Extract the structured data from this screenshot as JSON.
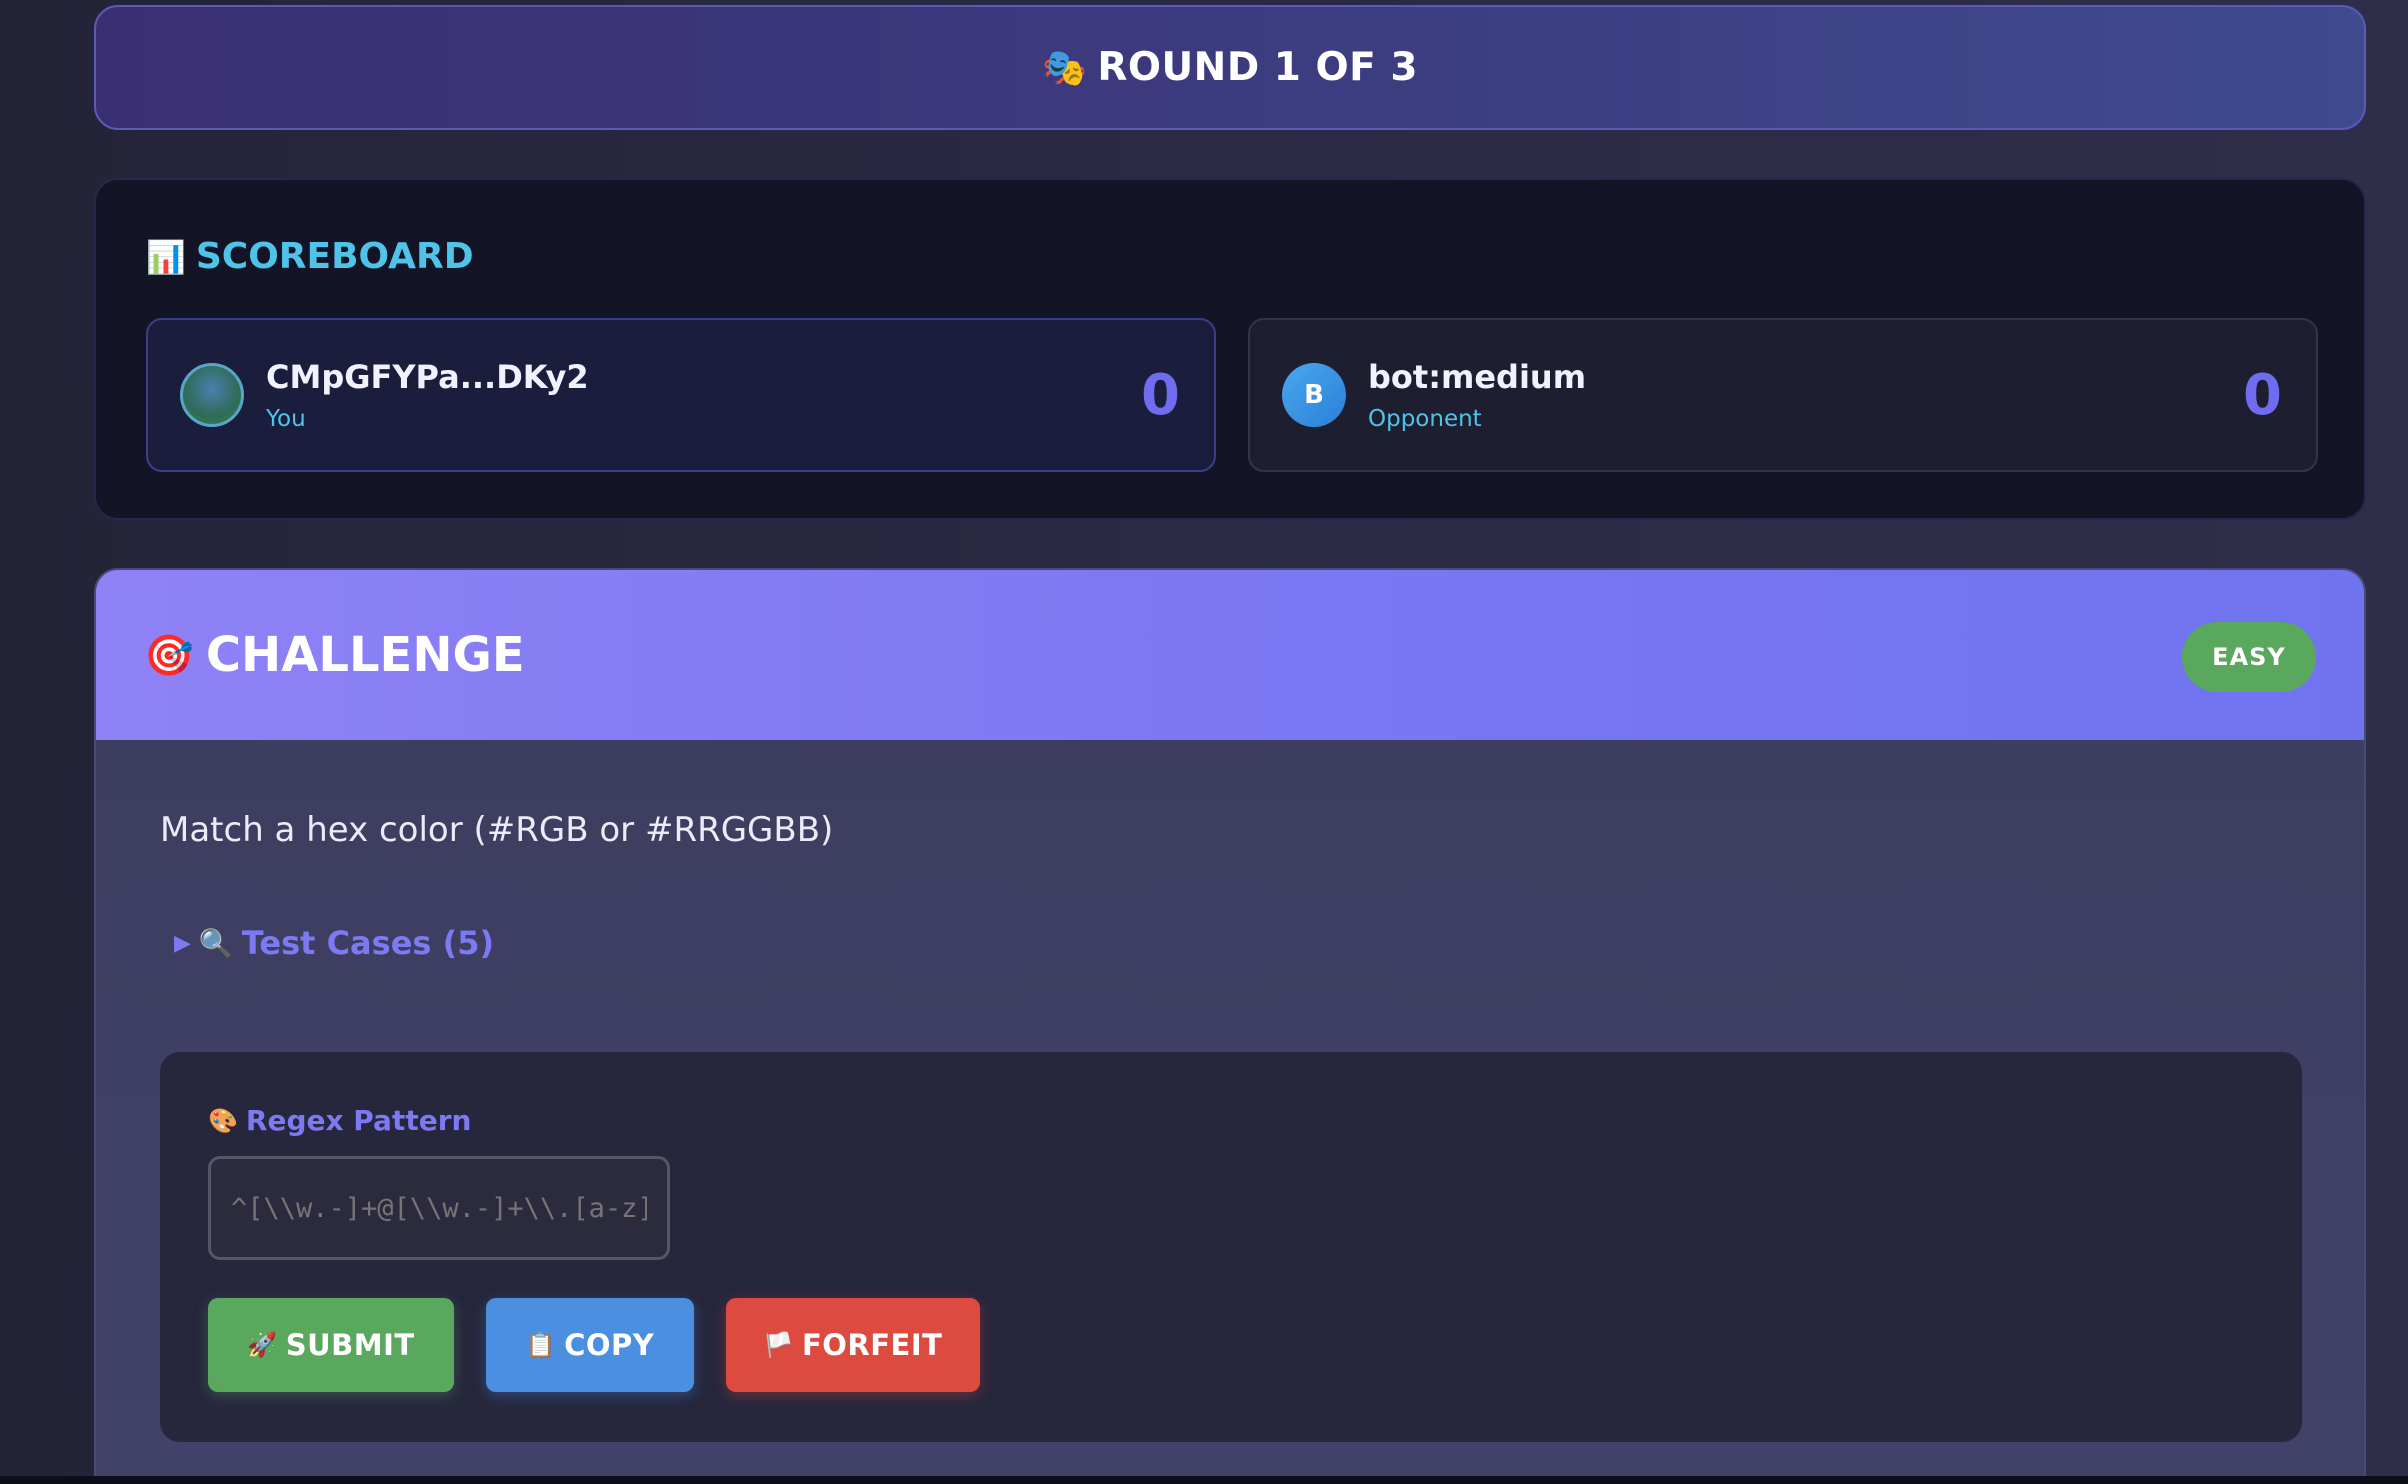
{
  "round": {
    "emoji": "🎭",
    "title": "ROUND 1 OF 3"
  },
  "scoreboard": {
    "emoji": "📊",
    "title": "SCOREBOARD",
    "players": [
      {
        "name": "CMpGFYPa...DKy2",
        "role": "You",
        "score": "0",
        "avatar_initial": ""
      },
      {
        "name": "bot:medium",
        "role": "Opponent",
        "score": "0",
        "avatar_initial": "B"
      }
    ]
  },
  "challenge": {
    "emoji": "🎯",
    "title": "CHALLENGE",
    "difficulty": "EASY",
    "description": "Match a hex color (#RGB or #RRGGBB)",
    "test_cases": {
      "arrow": "▶",
      "emoji": "🔍",
      "label": "Test Cases (5)"
    },
    "pattern": {
      "emoji": "🎨",
      "label": "Regex Pattern",
      "placeholder": "^[\\\\w.-]+@[\\\\w.-]+\\\\.[a-z]+$"
    },
    "buttons": {
      "submit": {
        "emoji": "🚀",
        "label": "SUBMIT"
      },
      "copy": {
        "emoji": "📋",
        "label": "COPY"
      },
      "forfeit": {
        "emoji": "🏳️",
        "label": "FORFEIT"
      }
    }
  },
  "colors": {
    "accent": "#7c79f2",
    "cyan": "#4fc3e8",
    "success": "#5aa85e",
    "info": "#4a8fe0",
    "danger": "#dc4a40"
  }
}
